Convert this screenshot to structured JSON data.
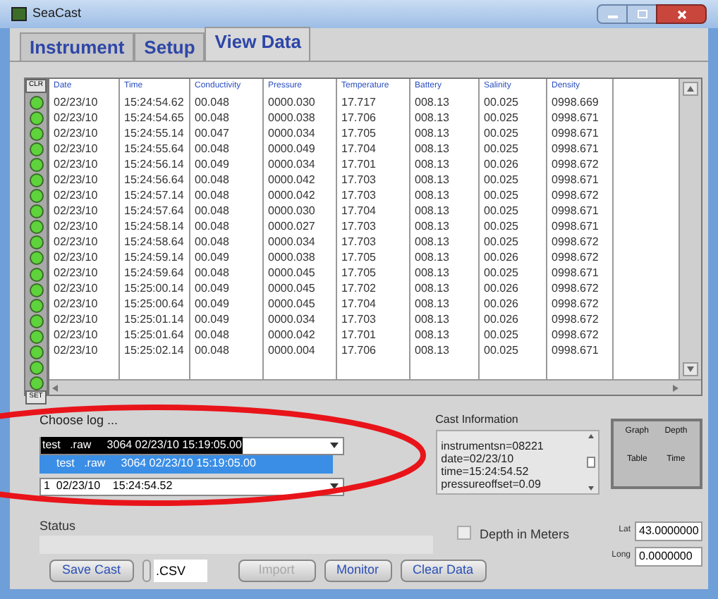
{
  "window": {
    "title": "SeaCast"
  },
  "tabs": [
    {
      "label": "Instrument",
      "selected": false
    },
    {
      "label": "Setup",
      "selected": false
    },
    {
      "label": "View Data",
      "selected": true
    }
  ],
  "led_panel": {
    "top_button": "CLR",
    "bottom_button": "SET",
    "leds": [
      {
        "on": true
      },
      {
        "on": true
      },
      {
        "on": true
      },
      {
        "on": true
      },
      {
        "on": true
      },
      {
        "on": true
      },
      {
        "on": true
      },
      {
        "on": true
      },
      {
        "on": true
      },
      {
        "on": true
      },
      {
        "on": true
      },
      {
        "on": true
      },
      {
        "on": true
      },
      {
        "on": true
      },
      {
        "on": true
      },
      {
        "on": true
      },
      {
        "on": true
      },
      {
        "on": true
      },
      {
        "on": true
      }
    ]
  },
  "table": {
    "columns": [
      "Date",
      "Time",
      "Conductivity",
      "Pressure",
      "Temperature",
      "Battery",
      "Salinity",
      "Density"
    ],
    "rows": [
      [
        "02/23/10",
        "15:24:54.62",
        "00.048",
        "0000.030",
        "17.717",
        "008.13",
        "00.025",
        "0998.669"
      ],
      [
        "02/23/10",
        "15:24:54.65",
        "00.048",
        "0000.038",
        "17.706",
        "008.13",
        "00.025",
        "0998.671"
      ],
      [
        "02/23/10",
        "15:24:55.14",
        "00.047",
        "0000.034",
        "17.705",
        "008.13",
        "00.025",
        "0998.671"
      ],
      [
        "02/23/10",
        "15:24:55.64",
        "00.048",
        "0000.049",
        "17.704",
        "008.13",
        "00.025",
        "0998.671"
      ],
      [
        "02/23/10",
        "15:24:56.14",
        "00.049",
        "0000.034",
        "17.701",
        "008.13",
        "00.026",
        "0998.672"
      ],
      [
        "02/23/10",
        "15:24:56.64",
        "00.048",
        "0000.042",
        "17.703",
        "008.13",
        "00.025",
        "0998.671"
      ],
      [
        "02/23/10",
        "15:24:57.14",
        "00.048",
        "0000.042",
        "17.703",
        "008.13",
        "00.025",
        "0998.672"
      ],
      [
        "02/23/10",
        "15:24:57.64",
        "00.048",
        "0000.030",
        "17.704",
        "008.13",
        "00.025",
        "0998.671"
      ],
      [
        "02/23/10",
        "15:24:58.14",
        "00.048",
        "0000.027",
        "17.703",
        "008.13",
        "00.025",
        "0998.671"
      ],
      [
        "02/23/10",
        "15:24:58.64",
        "00.048",
        "0000.034",
        "17.703",
        "008.13",
        "00.025",
        "0998.672"
      ],
      [
        "02/23/10",
        "15:24:59.14",
        "00.049",
        "0000.038",
        "17.705",
        "008.13",
        "00.026",
        "0998.672"
      ],
      [
        "02/23/10",
        "15:24:59.64",
        "00.048",
        "0000.045",
        "17.705",
        "008.13",
        "00.025",
        "0998.671"
      ],
      [
        "02/23/10",
        "15:25:00.14",
        "00.049",
        "0000.045",
        "17.702",
        "008.13",
        "00.026",
        "0998.672"
      ],
      [
        "02/23/10",
        "15:25:00.64",
        "00.049",
        "0000.045",
        "17.704",
        "008.13",
        "00.026",
        "0998.672"
      ],
      [
        "02/23/10",
        "15:25:01.14",
        "00.049",
        "0000.034",
        "17.703",
        "008.13",
        "00.026",
        "0998.672"
      ],
      [
        "02/23/10",
        "15:25:01.64",
        "00.048",
        "0000.042",
        "17.701",
        "008.13",
        "00.025",
        "0998.672"
      ],
      [
        "02/23/10",
        "15:25:02.14",
        "00.048",
        "0000.004",
        "17.706",
        "008.13",
        "00.025",
        "0998.671"
      ]
    ]
  },
  "choose_log": {
    "label": "Choose log ...",
    "value": "test   .raw     3064 02/23/10 15:19:05.00",
    "options": [
      {
        "label": "test   .raw     3064 02/23/10 15:19:05.00",
        "selected": true
      }
    ]
  },
  "choose_cast": {
    "value": "1  02/23/10    15:24:54.52"
  },
  "cast_information": {
    "label": "Cast Information",
    "lines": [
      "instrumentsn=08221",
      "date=02/23/10",
      "time=15:24:54.52",
      "pressureoffset=0.09"
    ]
  },
  "view_switch": {
    "labels": [
      "Graph",
      "Depth",
      "Table",
      "Time"
    ]
  },
  "status": {
    "label": "Status"
  },
  "depth_in_meters": {
    "label": "Depth in Meters",
    "checked": false
  },
  "lat": {
    "label": "Lat",
    "value": "43.0000000"
  },
  "long": {
    "label": "Long",
    "value": "0.0000000"
  },
  "buttons": [
    {
      "label": "Save Cast",
      "disabled": false
    },
    {
      "kind": "field",
      "value": ".CSV"
    },
    {
      "label": "Import",
      "disabled": true
    },
    {
      "label": "Monitor",
      "disabled": false
    },
    {
      "label": "Clear Data",
      "disabled": false
    }
  ]
}
